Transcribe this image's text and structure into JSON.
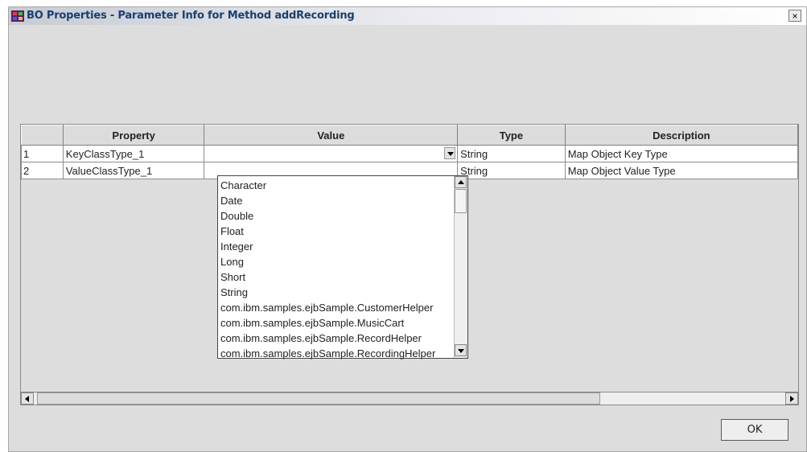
{
  "window": {
    "title": "BO Properties - Parameter Info for Method addRecording",
    "close_label": "×"
  },
  "table": {
    "columns": [
      "",
      "Property",
      "Value",
      "Type",
      "Description"
    ],
    "rows": [
      {
        "num": "1",
        "property": "KeyClassType_1",
        "value": "",
        "type": "String",
        "description": "Map Object Key Type"
      },
      {
        "num": "2",
        "property": "ValueClassType_1",
        "value": "",
        "type": "String",
        "description": "Map Object Value Type"
      }
    ]
  },
  "dropdown": {
    "options": [
      "Character",
      "Date",
      "Double",
      "Float",
      "Integer",
      "Long",
      "Short",
      "String",
      "com.ibm.samples.ejbSample.CustomerHelper",
      "com.ibm.samples.ejbSample.MusicCart",
      "com.ibm.samples.ejbSample.RecordHelper",
      "com.ibm.samples.ejbSample.RecordingHelper"
    ]
  },
  "buttons": {
    "ok_label": "OK"
  },
  "icons": {
    "title": "app-icon",
    "close": "close-icon",
    "dropdown_arrow": "chevron-down-icon",
    "scroll_up": "arrow-up-icon",
    "scroll_down": "arrow-down-icon",
    "scroll_left": "arrow-left-icon",
    "scroll_right": "arrow-right-icon"
  }
}
